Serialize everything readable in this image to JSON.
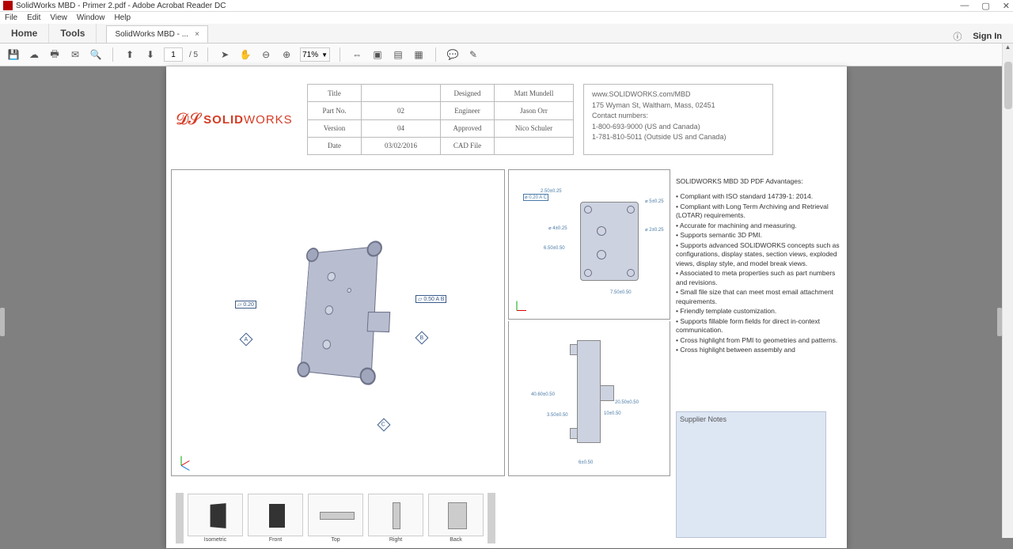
{
  "window": {
    "title": "SolidWorks MBD - Primer 2.pdf - Adobe Acrobat Reader DC"
  },
  "menu": {
    "file": "File",
    "edit": "Edit",
    "view": "View",
    "window": "Window",
    "help": "Help"
  },
  "tabs": {
    "home": "Home",
    "tools": "Tools",
    "doc": "SolidWorks MBD - ...",
    "signin": "Sign In"
  },
  "toolbar": {
    "page_current": "1",
    "page_total": "/ 5",
    "zoom": "71%"
  },
  "info_table": {
    "r0": {
      "label": "Title",
      "val": "",
      "label2": "Designed",
      "val2": "Matt Mundell"
    },
    "r1": {
      "label": "Part No.",
      "val": "02",
      "label2": "Engineer",
      "val2": "Jason Orr"
    },
    "r2": {
      "label": "Version",
      "val": "04",
      "label2": "Approved",
      "val2": "Nico Schuler"
    },
    "r3": {
      "label": "Date",
      "val": "03/02/2016",
      "label2": "CAD File",
      "val2": ""
    }
  },
  "contact": {
    "url": "www.SOLIDWORKS.com/MBD",
    "addr": "175 Wyman St, Waltham, Mass, 02451",
    "label": "Contact numbers:",
    "phone1": "1-800-693-9000  (US and Canada)",
    "phone2": "1-781-810-5011  (Outside US and Canada)"
  },
  "advantages": {
    "title": "SOLIDWORKS MBD 3D PDF Advantages:",
    "b1": "• Compliant with ISO standard 14739-1: 2014.",
    "b2": "• Compliant with Long Term Archiving and Retrieval (LOTAR) requirements.",
    "b3": "• Accurate for machining and measuring.",
    "b4": "• Supports semantic 3D PMI.",
    "b5": "• Supports advanced SOLIDWORKS concepts such as configurations, display states, section views, exploded views, display style, and model break views.",
    "b6": "• Associated to meta properties such as part numbers and revisions.",
    "b7": "• Small file size that can meet most email attachment requirements.",
    "b8": "• Friendly template customization.",
    "b9": "• Supports fillable form fields for direct in-context communication.",
    "b10": "• Cross highlight from PMI to geometries and patterns.",
    "b11": "• Cross highlight between assembly and"
  },
  "supplier": {
    "title": "Supplier Notes"
  },
  "callouts": {
    "flat1": "0.20",
    "flat2": "0.50  A  B"
  },
  "dims": {
    "st1": "2.50±0.25",
    "st2": "⌀ 0.20 A C",
    "st3": "⌀ 5±0.25",
    "st4": "⌀ 4±0.25",
    "st5": "6.50±0.50",
    "st6": "⌀ 2±0.25",
    "st7": "7.50±0.50",
    "sb1": "40.60±0.50",
    "sb2": "3.50±0.50",
    "sb3": "20.50±0.50",
    "sb4": "10±0.50",
    "sb5": "6±0.50"
  },
  "thumbs": {
    "t1": "Isometric",
    "t2": "Front",
    "t3": "Top",
    "t4": "Right",
    "t5": "Back"
  },
  "logo": {
    "bold": "SOLID",
    "thin": "WORKS"
  }
}
